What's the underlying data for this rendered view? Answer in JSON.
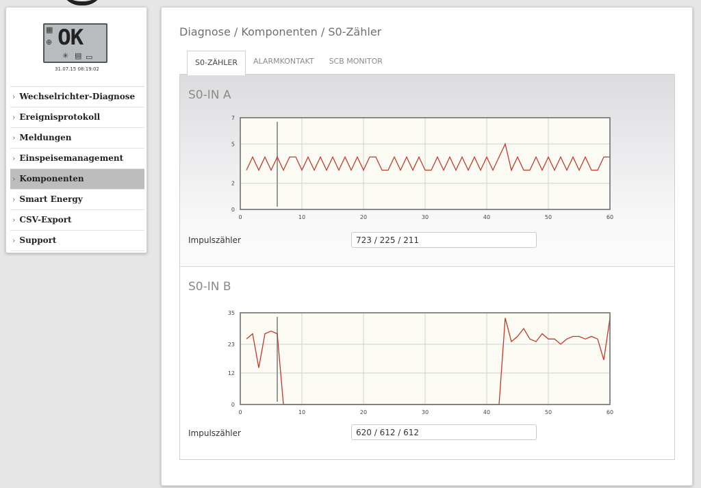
{
  "device": {
    "display_text": "OK",
    "datetime": "31.07.15 08:19:02"
  },
  "sidebar": {
    "items": [
      {
        "label": "Wechselrichter-Diagnose",
        "active": false
      },
      {
        "label": "Ereignisprotokoll",
        "active": false
      },
      {
        "label": "Meldungen",
        "active": false
      },
      {
        "label": "Einspeisemanagement",
        "active": false
      },
      {
        "label": "Komponenten",
        "active": true
      },
      {
        "label": "Smart Energy",
        "active": false
      },
      {
        "label": "CSV-Export",
        "active": false
      },
      {
        "label": "Support",
        "active": false
      }
    ]
  },
  "main": {
    "breadcrumb": "Diagnose / Komponenten / S0-Zähler",
    "tabs": [
      {
        "label": "S0-ZÄHLER",
        "active": true
      },
      {
        "label": "ALARMKONTAKT",
        "active": false
      },
      {
        "label": "SCB MONITOR",
        "active": false
      }
    ],
    "sections": [
      {
        "title": "S0-IN A",
        "counter_label": "Impulszähler",
        "counter_value": "723 / 225 / 211"
      },
      {
        "title": "S0-IN B",
        "counter_label": "Impulszähler",
        "counter_value": "620 / 612 / 612"
      }
    ]
  },
  "colors": {
    "line": "#c0392b",
    "plot_bg": "#fbfaf3",
    "cursor": "#999999",
    "active_menu": "#bdbdbd"
  },
  "chart_data": [
    {
      "type": "line",
      "title": "",
      "xlim": [
        0,
        60
      ],
      "ylim": [
        0,
        7
      ],
      "xticks": [
        0,
        10,
        20,
        30,
        40,
        50,
        60
      ],
      "yticks": [
        0,
        2,
        5,
        7
      ],
      "grid": true,
      "cursor_x": 6,
      "x": [
        1,
        2,
        3,
        4,
        5,
        6,
        7,
        8,
        9,
        10,
        11,
        12,
        13,
        14,
        15,
        16,
        17,
        18,
        19,
        20,
        21,
        22,
        23,
        24,
        25,
        26,
        27,
        28,
        29,
        30,
        31,
        32,
        33,
        34,
        35,
        36,
        37,
        38,
        39,
        40,
        41,
        42,
        43,
        44,
        45,
        46,
        47,
        48,
        49,
        50,
        51,
        52,
        53,
        54,
        55,
        56,
        57,
        58,
        59,
        60
      ],
      "y": [
        3,
        4,
        3,
        4,
        3,
        4,
        3,
        4,
        4,
        3,
        4,
        3,
        4,
        3,
        4,
        3,
        4,
        3,
        4,
        3,
        4,
        4,
        3,
        3,
        4,
        3,
        4,
        3,
        4,
        3,
        3,
        4,
        3,
        4,
        3,
        4,
        3,
        4,
        3,
        4,
        3,
        4,
        5,
        3,
        4,
        3,
        3,
        4,
        3,
        4,
        3,
        4,
        3,
        4,
        3,
        4,
        3,
        3,
        4,
        4
      ]
    },
    {
      "type": "line",
      "title": "",
      "xlim": [
        0,
        60
      ],
      "ylim": [
        0,
        35
      ],
      "xticks": [
        0,
        10,
        20,
        30,
        40,
        50,
        60
      ],
      "yticks": [
        0,
        12,
        23,
        35
      ],
      "grid": true,
      "cursor_x": 6,
      "x": [
        1,
        2,
        3,
        4,
        5,
        6,
        7,
        8,
        9,
        10,
        11,
        12,
        13,
        14,
        15,
        16,
        17,
        18,
        19,
        20,
        21,
        22,
        23,
        24,
        25,
        26,
        27,
        28,
        29,
        30,
        31,
        32,
        33,
        34,
        35,
        36,
        37,
        38,
        39,
        40,
        41,
        42,
        43,
        44,
        45,
        46,
        47,
        48,
        49,
        50,
        51,
        52,
        53,
        54,
        55,
        56,
        57,
        58,
        59,
        60
      ],
      "y": [
        25,
        27,
        14,
        27,
        28,
        27,
        0,
        0,
        0,
        0,
        0,
        0,
        0,
        0,
        0,
        0,
        0,
        0,
        0,
        0,
        0,
        0,
        0,
        0,
        0,
        0,
        0,
        0,
        0,
        0,
        0,
        0,
        0,
        0,
        0,
        0,
        0,
        0,
        0,
        0,
        0,
        0,
        33,
        24,
        26,
        29,
        25,
        24,
        27,
        25,
        25,
        23,
        25,
        26,
        26,
        25,
        26,
        25,
        17,
        33
      ]
    }
  ]
}
